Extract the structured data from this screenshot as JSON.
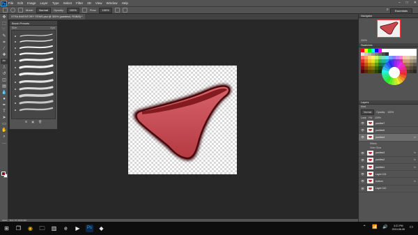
{
  "app": {
    "logo": "Ps"
  },
  "menu": [
    "File",
    "Edit",
    "Image",
    "Layer",
    "Type",
    "Select",
    "Filter",
    "3D",
    "View",
    "Window",
    "Help"
  ],
  "window_controls": {
    "minimize": "–",
    "maximize": "□",
    "close": "✕"
  },
  "options": {
    "mode_label": "Mode:",
    "mode_value": "Normal",
    "opacity_label": "Opacity:",
    "opacity_value": "100%",
    "flow_label": "Flow:",
    "flow_value": "100%",
    "workspace": "Essentials"
  },
  "document": {
    "tab": "XTRA INVENTORY ITEMS.psd @ 300% (panties4, RGB/8) *"
  },
  "brush_presets": {
    "title": "Brush Presets",
    "size_label": "Size:",
    "size_value": "4 px"
  },
  "navigator": {
    "tab": "Navigator",
    "zoom": "300%"
  },
  "swatches": {
    "tab": "Swatches",
    "colors": [
      "#ff0000",
      "#ffff00",
      "#00ff00",
      "#00ffff",
      "#0000ff",
      "#ff00ff",
      "#ffffff",
      "#ffffff",
      "#ffffff",
      "#ffffff",
      "#ffffff",
      "#ffffff",
      "#ffffff",
      "#ffffff",
      "#ffffff",
      "#ffffff",
      "#e6e6e6",
      "#cccccc",
      "#b3b3b3",
      "#999999",
      "#808080",
      "#666666",
      "#4d4d4d",
      "#333333",
      "#ffffff",
      "#ffffff",
      "#ffffff",
      "#ffffff",
      "#ffffff",
      "#ffffff",
      "#ffffff",
      "#ffffff",
      "#ff6e6e",
      "#ff9e63",
      "#ffd966",
      "#fff066",
      "#c8f56a",
      "#7fe07f",
      "#6ee0c0",
      "#66d9ff",
      "#6ea3ff",
      "#8a7fff",
      "#c27fff",
      "#ff7fd6",
      "#f2c6b6",
      "#e6d0b0",
      "#cfc2ad",
      "#bfb8a8",
      "#e62e2e",
      "#f27a26",
      "#f2c21f",
      "#e8e21a",
      "#8fd124",
      "#2fb347",
      "#1fb396",
      "#1aa8d9",
      "#2466d9",
      "#4a3cc7",
      "#9233c2",
      "#d92b9c",
      "#d9957a",
      "#c9a37a",
      "#a89476",
      "#8f8a7a",
      "#b31a1a",
      "#c25514",
      "#c28f0f",
      "#b8b00f",
      "#5f9e14",
      "#1a7d31",
      "#0f7d69",
      "#0f76a3",
      "#1440a3",
      "#2a1f94",
      "#661c8f",
      "#a31a70",
      "#b36a52",
      "#a07a52",
      "#7d6a54",
      "#5e594f",
      "#7a0f14",
      "#8a3a0c",
      "#8a6608",
      "#807a0a",
      "#3d6b0c",
      "#0f5220",
      "#0a5246",
      "#0a4f6e",
      "#0c2a70",
      "#1a1366",
      "#461463",
      "#70124d",
      "#8a4a38",
      "#73573a",
      "#574a3b",
      "#3d3a34",
      "#4d0a0d",
      "#5c2608",
      "#5c4405",
      "#545006",
      "#284708",
      "#0a3615",
      "#06362e",
      "#063448",
      "#081c4a",
      "#110d44",
      "#2e0d42",
      "#4a0c33",
      "#5e3326",
      "#4d3a27",
      "#3b3228",
      "#292723"
    ]
  },
  "layers": {
    "tab": "Layers",
    "kind_label": "Kind",
    "blend": "Normal",
    "opacity_label": "Opacity:",
    "opacity": "100%",
    "lock_label": "Lock:",
    "fill_label": "Fill:",
    "fill": "100%",
    "items": [
      {
        "name": "panties7",
        "selected": false,
        "fx": ""
      },
      {
        "name": "panties5",
        "selected": false,
        "fx": ""
      },
      {
        "name": "panties4",
        "selected": true,
        "fx": "fx"
      }
    ],
    "effects_label": "Effects",
    "outer_glow": "Outer Glow",
    "items_after": [
      {
        "name": "panties3",
        "fx": "fx"
      },
      {
        "name": "panties2",
        "fx": "fx"
      },
      {
        "name": "panties1",
        "fx": "fx"
      },
      {
        "name": "Layer 101",
        "fx": ""
      },
      {
        "name": "bottom",
        "fx": "fx"
      },
      {
        "name": "Layer 110",
        "fx": ""
      }
    ]
  },
  "status": {
    "zoom": "300%",
    "doc": "Doc: 57.1K/11.6M"
  },
  "taskbar": {
    "time": "3:21 PM",
    "date": "2019-08-06",
    "colors": {
      "start": "#ffffff",
      "chrome": "#e8b41b",
      "photoshop": "#31a8ff"
    }
  },
  "colors": {
    "foreground": "#7a0f14",
    "background": "#ffffff",
    "garment": "#c9484e",
    "garment_dark": "#4a0a0c"
  }
}
